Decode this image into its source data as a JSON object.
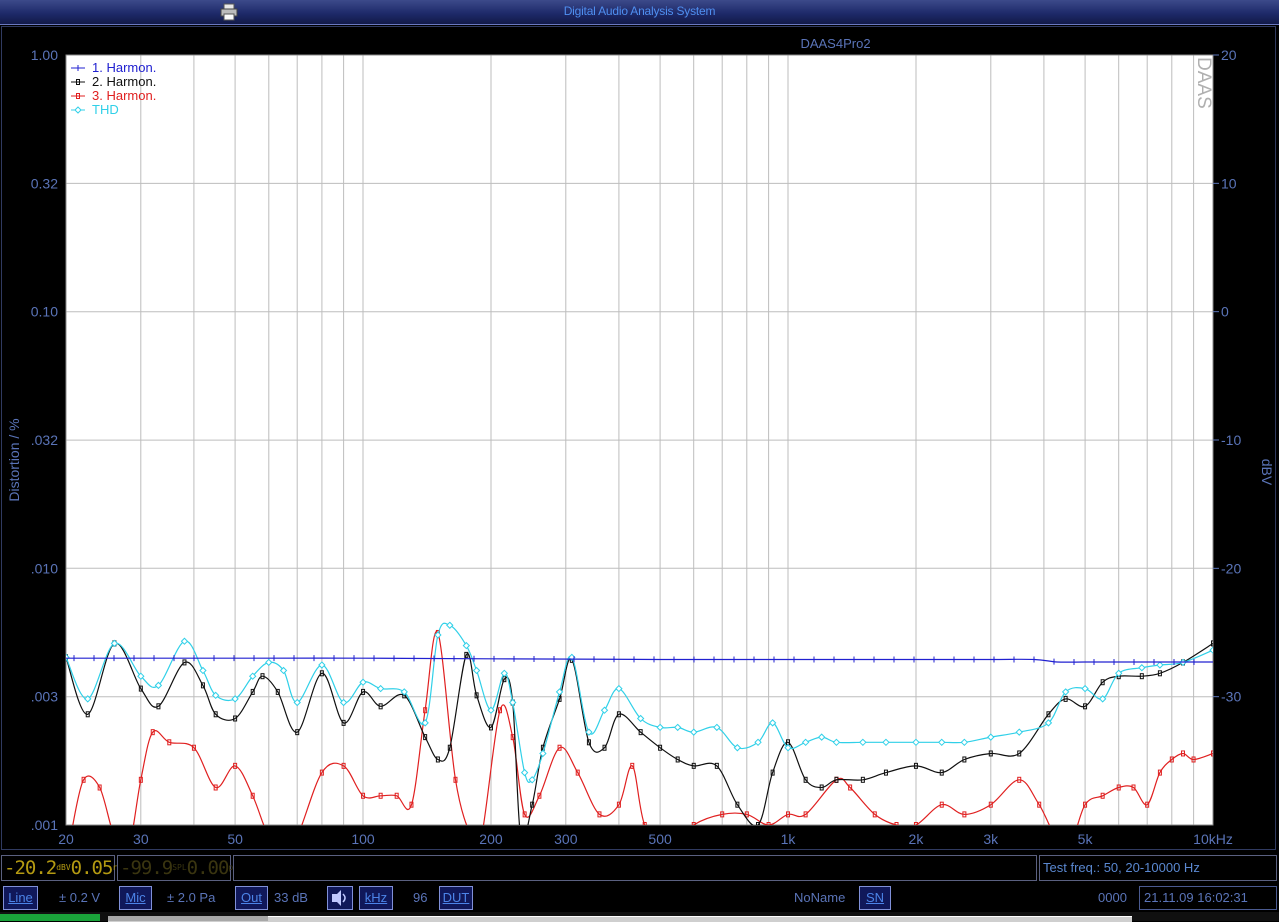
{
  "window": {
    "title": "Digital Audio Analysis System"
  },
  "chart_data": {
    "type": "line",
    "title": "DAAS4Pro2",
    "watermark": "DAAS",
    "xlabel": "",
    "ylabel": "Distortion / %",
    "ylabel_right": "dBV",
    "x_scale": "log",
    "y_scale": "log",
    "xlim": [
      20,
      10000
    ],
    "ylim": [
      0.001,
      1.0
    ],
    "ylim_right": [
      -40,
      20
    ],
    "x_ticks": [
      20,
      30,
      50,
      100,
      200,
      300,
      500,
      1000,
      2000,
      3000,
      5000,
      10000
    ],
    "x_tick_labels": [
      "20",
      "30",
      "50",
      "100",
      "200",
      "300",
      "500",
      "1k",
      "2k",
      "3k",
      "5k",
      "10kHz"
    ],
    "y_ticks": [
      0.001,
      0.00316,
      0.01,
      0.0316,
      0.1,
      0.316,
      1.0
    ],
    "y_tick_labels": [
      ".001",
      ".003",
      ".010",
      ".032",
      "0.10",
      "0.32",
      "1.00"
    ],
    "y_right_ticks": [
      -30,
      -20,
      -10,
      0,
      10,
      20
    ],
    "y_right_tick_labels": [
      "-30",
      "-20",
      "-10",
      "0",
      "10",
      "20"
    ],
    "grid": true,
    "legend_position": "top-left",
    "series": [
      {
        "name": "1. Harmon.",
        "color": "#2020d0",
        "axis": "right",
        "marker": "plus",
        "x": [
          20,
          50,
          100,
          200,
          500,
          1000,
          2000,
          3000,
          3800,
          4300,
          5000,
          7000,
          10000
        ],
        "y": [
          -27.0,
          -27.0,
          -27.0,
          -27.05,
          -27.1,
          -27.1,
          -27.1,
          -27.1,
          -27.1,
          -27.3,
          -27.3,
          -27.3,
          -27.3
        ]
      },
      {
        "name": "2. Harmon.",
        "color": "#101010",
        "axis": "left",
        "marker": "square",
        "x": [
          20,
          22.5,
          26,
          30,
          33,
          38,
          42,
          45,
          50,
          55,
          58,
          63,
          70,
          80,
          90,
          100,
          110,
          125,
          140,
          150,
          160,
          175,
          185,
          200,
          215,
          225,
          235,
          250,
          265,
          290,
          310,
          340,
          370,
          400,
          450,
          500,
          550,
          600,
          680,
          760,
          850,
          920,
          1000,
          1100,
          1200,
          1300,
          1500,
          1700,
          2000,
          2300,
          2600,
          3000,
          3500,
          4100,
          4500,
          5000,
          5500,
          6000,
          6800,
          7500,
          8500,
          10000
        ],
        "y": [
          0.0045,
          0.0027,
          0.0051,
          0.0034,
          0.0029,
          0.0043,
          0.0035,
          0.0027,
          0.0026,
          0.0033,
          0.0038,
          0.0033,
          0.0023,
          0.0039,
          0.0025,
          0.0033,
          0.0029,
          0.0032,
          0.0022,
          0.0018,
          0.002,
          0.0046,
          0.0032,
          0.0024,
          0.0037,
          0.003,
          0.0009,
          0.0012,
          0.002,
          0.0031,
          0.0044,
          0.0021,
          0.002,
          0.0027,
          0.0023,
          0.002,
          0.0018,
          0.0017,
          0.0017,
          0.0012,
          0.001,
          0.0016,
          0.0021,
          0.0015,
          0.0014,
          0.0015,
          0.0015,
          0.0016,
          0.0017,
          0.0016,
          0.0018,
          0.0019,
          0.0019,
          0.0027,
          0.0031,
          0.0029,
          0.0036,
          0.0038,
          0.0038,
          0.0039,
          0.0043,
          0.0051
        ]
      },
      {
        "name": "3. Harmon.",
        "color": "#e02020",
        "axis": "left",
        "marker": "square",
        "x": [
          20.5,
          22,
          24,
          26,
          28,
          30,
          32,
          35,
          40,
          45,
          50,
          55,
          60,
          65,
          70,
          80,
          90,
          100,
          110,
          120,
          130,
          140,
          150,
          165,
          180,
          190,
          210,
          225,
          240,
          260,
          290,
          320,
          360,
          400,
          430,
          460,
          520,
          600,
          700,
          800,
          900,
          1000,
          1100,
          1300,
          1400,
          1600,
          1800,
          2000,
          2300,
          2600,
          3000,
          3500,
          3900,
          4500,
          5000,
          5500,
          6000,
          6500,
          7000,
          7500,
          8000,
          8500,
          9000,
          10000
        ],
        "y": [
          0.0009,
          0.0015,
          0.0014,
          0.0009,
          0.0008,
          0.0015,
          0.0023,
          0.0021,
          0.002,
          0.0014,
          0.0017,
          0.0013,
          0.0009,
          0.0008,
          0.0009,
          0.0016,
          0.0017,
          0.0013,
          0.0013,
          0.0013,
          0.0012,
          0.0028,
          0.0056,
          0.0015,
          0.0009,
          0.0009,
          0.0028,
          0.0022,
          0.0011,
          0.0013,
          0.002,
          0.0016,
          0.0011,
          0.0012,
          0.0017,
          0.001,
          0.0008,
          0.001,
          0.0011,
          0.0011,
          0.001,
          0.0011,
          0.0011,
          0.0015,
          0.0014,
          0.0011,
          0.001,
          0.001,
          0.0012,
          0.0011,
          0.0012,
          0.0015,
          0.0012,
          0.0008,
          0.0012,
          0.0013,
          0.0014,
          0.0014,
          0.0012,
          0.0016,
          0.0018,
          0.0019,
          0.0018,
          0.0019
        ]
      },
      {
        "name": "THD",
        "color": "#30d0e8",
        "axis": "left",
        "marker": "diamond",
        "x": [
          20,
          22.5,
          26,
          30,
          33,
          38,
          42,
          45,
          50,
          55,
          60,
          65,
          70,
          80,
          90,
          100,
          110,
          125,
          140,
          150,
          160,
          175,
          185,
          200,
          215,
          225,
          240,
          250,
          265,
          290,
          310,
          340,
          370,
          400,
          450,
          500,
          550,
          600,
          680,
          760,
          850,
          920,
          1000,
          1100,
          1200,
          1300,
          1500,
          1700,
          2000,
          2300,
          2600,
          3000,
          3500,
          4100,
          4500,
          5000,
          5500,
          6000,
          6800,
          7500,
          8500,
          10000
        ],
        "y": [
          0.0045,
          0.0031,
          0.0051,
          0.0038,
          0.0035,
          0.0052,
          0.004,
          0.0032,
          0.0031,
          0.0038,
          0.0043,
          0.004,
          0.003,
          0.0042,
          0.003,
          0.0036,
          0.0034,
          0.0033,
          0.0025,
          0.0055,
          0.006,
          0.005,
          0.004,
          0.0028,
          0.0039,
          0.003,
          0.0016,
          0.0015,
          0.0019,
          0.0033,
          0.0045,
          0.0023,
          0.0028,
          0.0034,
          0.0026,
          0.0024,
          0.0024,
          0.0023,
          0.0024,
          0.002,
          0.0021,
          0.0025,
          0.002,
          0.0021,
          0.0022,
          0.0021,
          0.0021,
          0.0021,
          0.0021,
          0.0021,
          0.0021,
          0.0022,
          0.0023,
          0.0025,
          0.0033,
          0.0034,
          0.0031,
          0.0039,
          0.0041,
          0.0042,
          0.0043,
          0.0048
        ]
      }
    ]
  },
  "status": {
    "level_value": "-20.2",
    "level_unit_top": "dBV",
    "level_unit_bottom": "",
    "rms_value": "0.05",
    "rms_unit": "rms",
    "spl_value": "-99.9",
    "spl_unit": "SPL",
    "peak_value": "0.00",
    "peak_unit": "peak",
    "test_freq": "Test freq.: 50, 20-10000 Hz"
  },
  "toolbar": {
    "line_label": "Line",
    "line_range": "± 0.2 V",
    "mic_label": "Mic",
    "mic_range": "± 2.0 Pa",
    "out_label": "Out",
    "out_value": "33 dB",
    "khz_label": "kHz",
    "khz_value": "96",
    "dut_label": "DUT",
    "name_value": "NoName",
    "sn_label": "SN",
    "counter": "0000",
    "datetime": "21.11.09 16:02:31"
  },
  "colors": {
    "background": "#000000",
    "plot_bg": "#ffffff",
    "axis_text": "#5a74b8",
    "grid": "#bdbdbd"
  }
}
